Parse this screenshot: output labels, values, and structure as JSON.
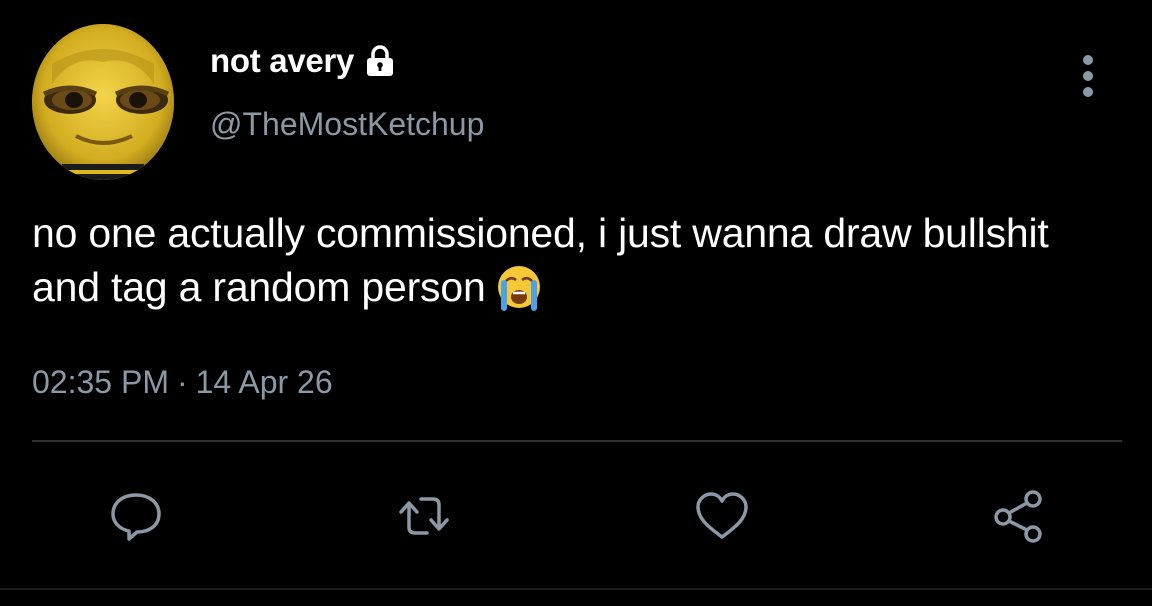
{
  "tweet": {
    "author": {
      "display_name": "not avery",
      "handle": "@TheMostKetchup",
      "protected_icon": "lock-icon",
      "avatar": "bee-face-avatar"
    },
    "text": "no one actually commissioned, i just wanna draw bullshit and tag a random person",
    "emoji": "loudly-crying-face",
    "time": "02:35 PM",
    "separator": "·",
    "date": "14 Apr 26"
  },
  "actions": {
    "reply": "reply-icon",
    "retweet": "retweet-icon",
    "like": "heart-icon",
    "share": "share-icon",
    "more": "more-vertical-icon"
  },
  "colors": {
    "background": "#000000",
    "primary_text": "#ffffff",
    "secondary_text": "#8b98a5",
    "divider": "#2f3336"
  }
}
